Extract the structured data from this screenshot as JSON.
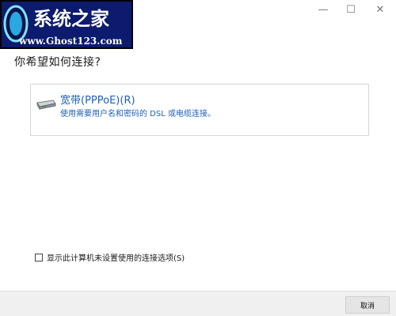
{
  "watermark": {
    "title": "系统之家",
    "url": "www.Ghost123.com"
  },
  "titlebar": {
    "minimize": "—",
    "maximize": "☐",
    "close": "✕"
  },
  "question": "你希望如何连接?",
  "option": {
    "title": "宽带(PPPoE)(R)",
    "description": "使用需要用户名和密码的 DSL 或电缆连接。",
    "icon": "modem-icon"
  },
  "checkbox": {
    "label": "显示此计算机未设置使用的连接选项(S)",
    "checked": false
  },
  "footer": {
    "cancel": "取消"
  },
  "colors": {
    "link_blue": "#1e5fb8",
    "footer_bg": "#f0f0f0",
    "logo_bg": "#0c1b6e"
  }
}
